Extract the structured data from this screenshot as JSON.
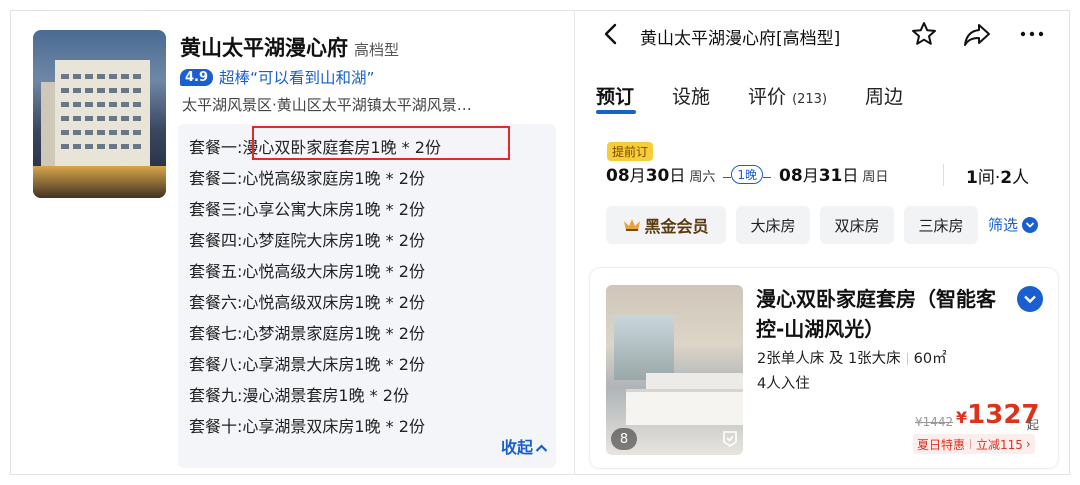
{
  "hotel": {
    "name": "黄山太平湖漫心府",
    "grade": "高档型",
    "score": "4.9",
    "rating_text": "超棒“可以看到山和湖”",
    "address": "太平湖风景区·黄山区太平湖镇太平湖风景…"
  },
  "packages": {
    "items": [
      {
        "label": "套餐一:",
        "value": "漫心双卧家庭套房1晚 * 2份"
      },
      {
        "label": "套餐二:",
        "value": "心悦高级家庭房1晚 * 2份"
      },
      {
        "label": "套餐三:",
        "value": "心享公寓大床房1晚 * 2份"
      },
      {
        "label": "套餐四:",
        "value": "心梦庭院大床房1晚 * 2份"
      },
      {
        "label": "套餐五:",
        "value": "心悦高级大床房1晚 * 2份"
      },
      {
        "label": "套餐六:",
        "value": "心悦高级双床房1晚 * 2份"
      },
      {
        "label": "套餐七:",
        "value": "心梦湖景家庭房1晚 * 2份"
      },
      {
        "label": "套餐八:",
        "value": "心享湖景大床房1晚 * 2份"
      },
      {
        "label": "套餐九:",
        "value": "漫心湖景套房1晚 * 2份"
      },
      {
        "label": "套餐十:",
        "value": "心享湖景双床房1晚 * 2份"
      }
    ],
    "collapse_label": "收起"
  },
  "nav": {
    "title": "黄山太平湖漫心府[高档型]",
    "icons": [
      "back-icon",
      "star-icon",
      "share-icon",
      "more-icon"
    ]
  },
  "tabs": [
    {
      "label": "预订"
    },
    {
      "label": "设施"
    },
    {
      "label": "评价",
      "count": "(213)"
    },
    {
      "label": "周边"
    }
  ],
  "booking": {
    "prebook_tag": "提前订",
    "checkin_month": "08",
    "checkin_day": "30",
    "checkin_weekday": "周六",
    "nights": "1晚",
    "checkout_month": "08",
    "checkout_day": "31",
    "checkout_weekday": "周日",
    "rooms": "1",
    "rooms_unit": "间",
    "guests": "2",
    "guests_unit": "人"
  },
  "filters": {
    "chips": [
      "黑金会员",
      "大床房",
      "双床房",
      "三床房"
    ],
    "more_label": "筛选"
  },
  "room": {
    "name": "漫心双卧家庭套房（智能客控-山湖风光）",
    "beds": "2张单人床 及 1张大床",
    "area": "60㎡",
    "occupancy": "4人入住",
    "photo_count": "8",
    "original_price": "¥1442",
    "currency": "¥",
    "price": "1327",
    "price_suffix": "起",
    "promo_label": "夏日特惠",
    "promo_discount": "立减115"
  },
  "colors": {
    "accent": "#1a5fcf",
    "price": "#e0311b",
    "highlight": "#e12a2a",
    "prebook_tag": "#f4cd38"
  }
}
